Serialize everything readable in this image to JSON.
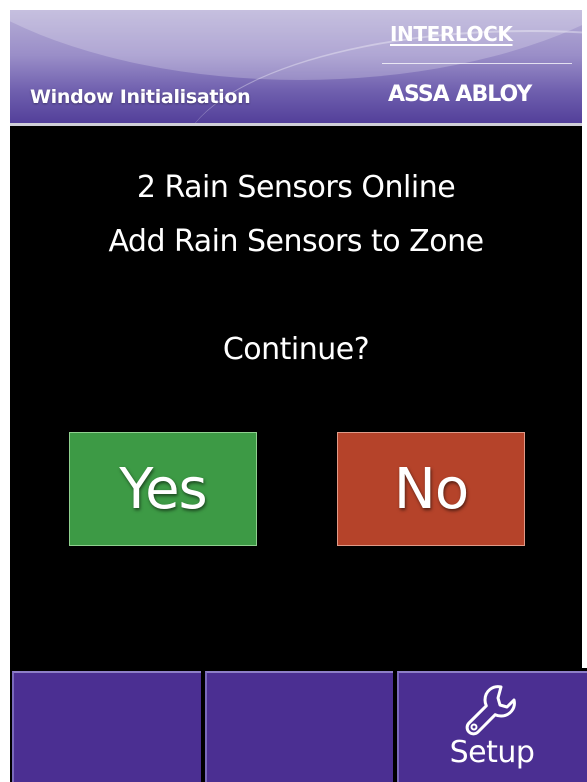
{
  "header": {
    "title": "Window Initialisation",
    "brand_top": "INTERLOCK",
    "brand_bottom": "ASSA ABLOY"
  },
  "dialog": {
    "line1": "2 Rain Sensors Online",
    "line2": "Add Rain Sensors to Zone",
    "question": "Continue?",
    "yes_label": "Yes",
    "no_label": "No"
  },
  "footer": {
    "buttons": [
      {
        "label": ""
      },
      {
        "label": ""
      },
      {
        "label": "Setup",
        "icon": "wrench-icon"
      }
    ]
  },
  "colors": {
    "yes": "#3d9a45",
    "no": "#b5432a",
    "nav": "#4b2f92",
    "header": "#6f5fae",
    "background": "#000000"
  }
}
